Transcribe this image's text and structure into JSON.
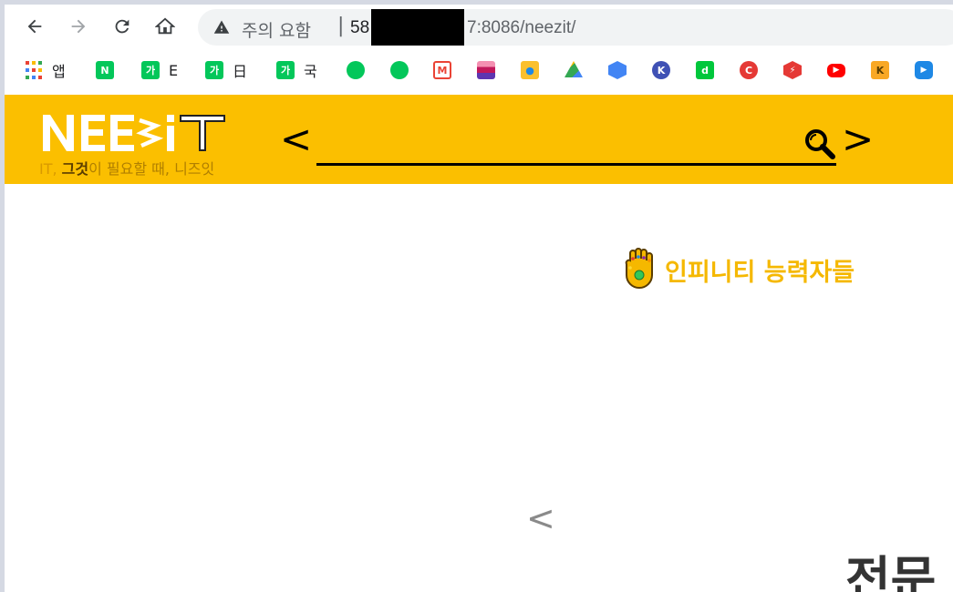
{
  "browser": {
    "warning_text": "주의 요함",
    "separator": "|",
    "url_prefix": "58",
    "url_suffix": "7:8086/neezit/"
  },
  "bookmarks": [
    {
      "label": "앱",
      "icon": "apps-grid-icon",
      "color": "#ea4335"
    },
    {
      "label": "",
      "icon": "naver-icon",
      "color": "#03c75a",
      "glyph": "N"
    },
    {
      "label": "E",
      "icon": "naver-dict-icon",
      "color": "#03c75a",
      "glyph": "가"
    },
    {
      "label": "日",
      "icon": "naver-dict-icon",
      "color": "#03c75a",
      "glyph": "가"
    },
    {
      "label": "국",
      "icon": "naver-dict-icon",
      "color": "#03c75a",
      "glyph": "가"
    },
    {
      "label": "",
      "icon": "cafe-icon",
      "color": "#03c75a"
    },
    {
      "label": "",
      "icon": "mail-icon",
      "color": "#03c75a"
    },
    {
      "label": "",
      "icon": "gmail-icon",
      "color": "#ea4335"
    },
    {
      "label": "",
      "icon": "flag-icon",
      "color": "#c2185b"
    },
    {
      "label": "",
      "icon": "map-pin-icon",
      "color": "#fbc02d"
    },
    {
      "label": "",
      "icon": "drive-icon",
      "color": "#34a853"
    },
    {
      "label": "",
      "icon": "cube-icon",
      "color": "#4285f4"
    },
    {
      "label": "",
      "icon": "kbh-icon",
      "color": "#3f51b5"
    },
    {
      "label": "",
      "icon": "d-icon",
      "color": "#00c73c",
      "glyph": "d"
    },
    {
      "label": "",
      "icon": "c-icon",
      "color": "#e53935",
      "glyph": "C"
    },
    {
      "label": "",
      "icon": "lightning-icon",
      "color": "#e53935"
    },
    {
      "label": "",
      "icon": "youtube-icon",
      "color": "#ff0000"
    },
    {
      "label": "",
      "icon": "kakao-icon",
      "color": "#f9a825"
    },
    {
      "label": "",
      "icon": "play-icon",
      "color": "#1e88e5"
    }
  ],
  "header": {
    "logo_text": "NEEZIT",
    "tagline_prefix": "IT, ",
    "tagline_mid": "그것",
    "tagline_suffix": "이 필요할 때, 니즈잇",
    "search_left": "<",
    "search_right": ">",
    "search_value": "",
    "brand_color": "#fbbf00"
  },
  "main": {
    "section_title": "인피니티 능력자들",
    "carousel_prev": "<",
    "big_heading": "전문"
  }
}
